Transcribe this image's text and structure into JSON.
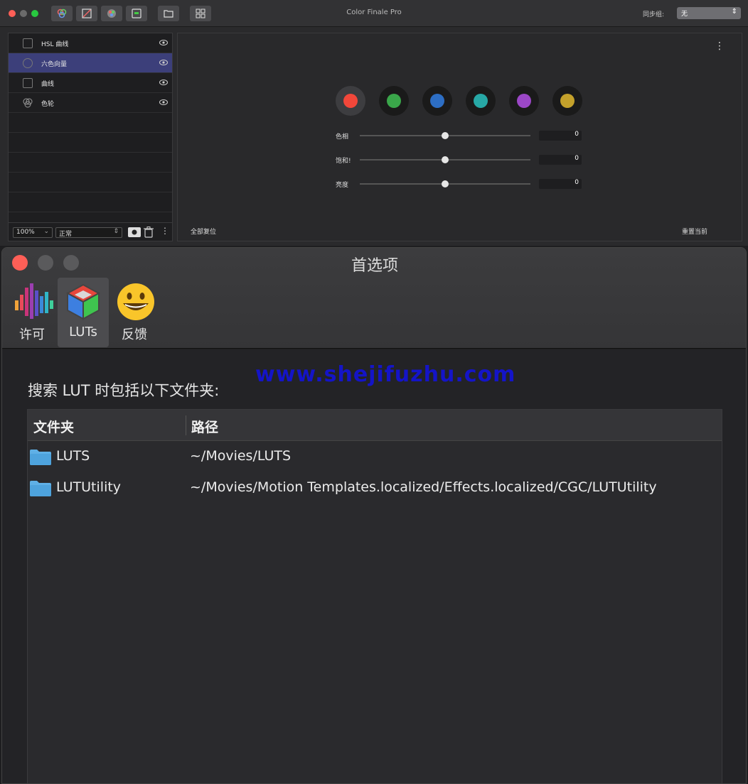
{
  "colors": {
    "accent_selected": "#3c3f7a",
    "watermark": "#1414c8",
    "close": "#ff5f57",
    "minimize": "#febc2e",
    "zoom": "#28c840"
  },
  "cf_window": {
    "title": "Color Finale Pro",
    "sync_label": "同步组:",
    "sync_value": "无",
    "toolbar_icons": [
      "color-wheels-icon",
      "curves-tool-icon",
      "color-picker-icon",
      "frame-icon",
      "folder-icon",
      "grid-icon"
    ],
    "layers": [
      {
        "name": "HSL 曲线",
        "icon": "curve-box-icon"
      },
      {
        "name": "六色向量",
        "icon": "vector-circle-icon",
        "selected": true
      },
      {
        "name": "曲线",
        "icon": "curve-box-icon"
      },
      {
        "name": "色轮",
        "icon": "color-wheel-icon"
      }
    ],
    "zoom_value": "100%",
    "blend_value": "正常",
    "swatches": [
      "#f2473a",
      "#3aa64a",
      "#2d6ec4",
      "#27a8a6",
      "#9b47c6",
      "#c4a12b"
    ],
    "sliders": [
      {
        "label": "色相",
        "value": "0",
        "level": 0.5
      },
      {
        "label": "饱和!",
        "value": "0",
        "level": 0.5
      },
      {
        "label": "亮度",
        "value": "0",
        "level": 0.5
      }
    ],
    "reset_all": "全部复位",
    "reset_current": "重置当前"
  },
  "pref_window": {
    "title": "首选项",
    "tabs": [
      {
        "label": "许可",
        "icon": "license-bars-icon"
      },
      {
        "label": "LUTs",
        "icon": "lut-cube-icon",
        "active": true
      },
      {
        "label": "反馈",
        "icon": "smiley-icon"
      }
    ],
    "watermark": "www.shejifuzhu.com",
    "heading": "搜索 LUT 时包括以下文件夹:",
    "table": {
      "headers": [
        "文件夹",
        "路径"
      ],
      "rows": [
        {
          "name": "LUTS",
          "path": "~/Movies/LUTS"
        },
        {
          "name": "LUTUtility",
          "path": "~/Movies/Motion Templates.localized/Effects.localized/CGC/LUTUtility"
        }
      ]
    }
  }
}
